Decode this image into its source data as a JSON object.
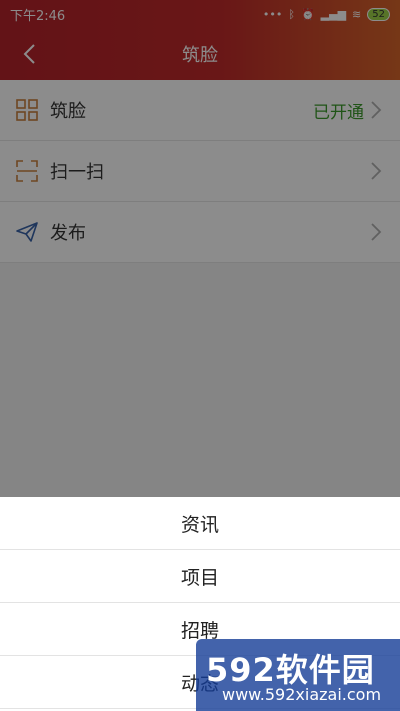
{
  "status_bar": {
    "time": "下午2:46",
    "battery": "52"
  },
  "nav": {
    "title": "筑脸"
  },
  "list": [
    {
      "label": "筑脸",
      "value": "已开通"
    },
    {
      "label": "扫一扫",
      "value": ""
    },
    {
      "label": "发布",
      "value": ""
    }
  ],
  "sheet": {
    "items": [
      "资讯",
      "项目",
      "招聘",
      "动态"
    ]
  },
  "watermark": {
    "brand": "592软件园",
    "url": "www.592xiazai.com"
  },
  "colors": {
    "header_start": "#b4232b",
    "header_end": "#d7652b",
    "status_value": "#3b9a2b",
    "icon_orange": "#c9803e",
    "icon_blue": "#3a63a8"
  }
}
